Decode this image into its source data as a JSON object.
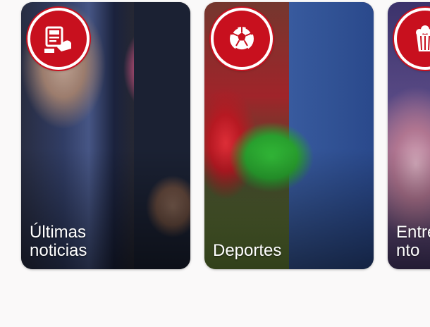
{
  "categories": [
    {
      "label": "Últimas\nnoticias",
      "icon": "newspaper-hand-icon"
    },
    {
      "label": "Deportes",
      "icon": "soccer-ball-icon"
    },
    {
      "label": "Entretenimie\nnto",
      "icon": "popcorn-icon"
    }
  ],
  "colors": {
    "accent": "#c8101e",
    "background": "#faf9f9",
    "label_text": "#ffffff"
  }
}
